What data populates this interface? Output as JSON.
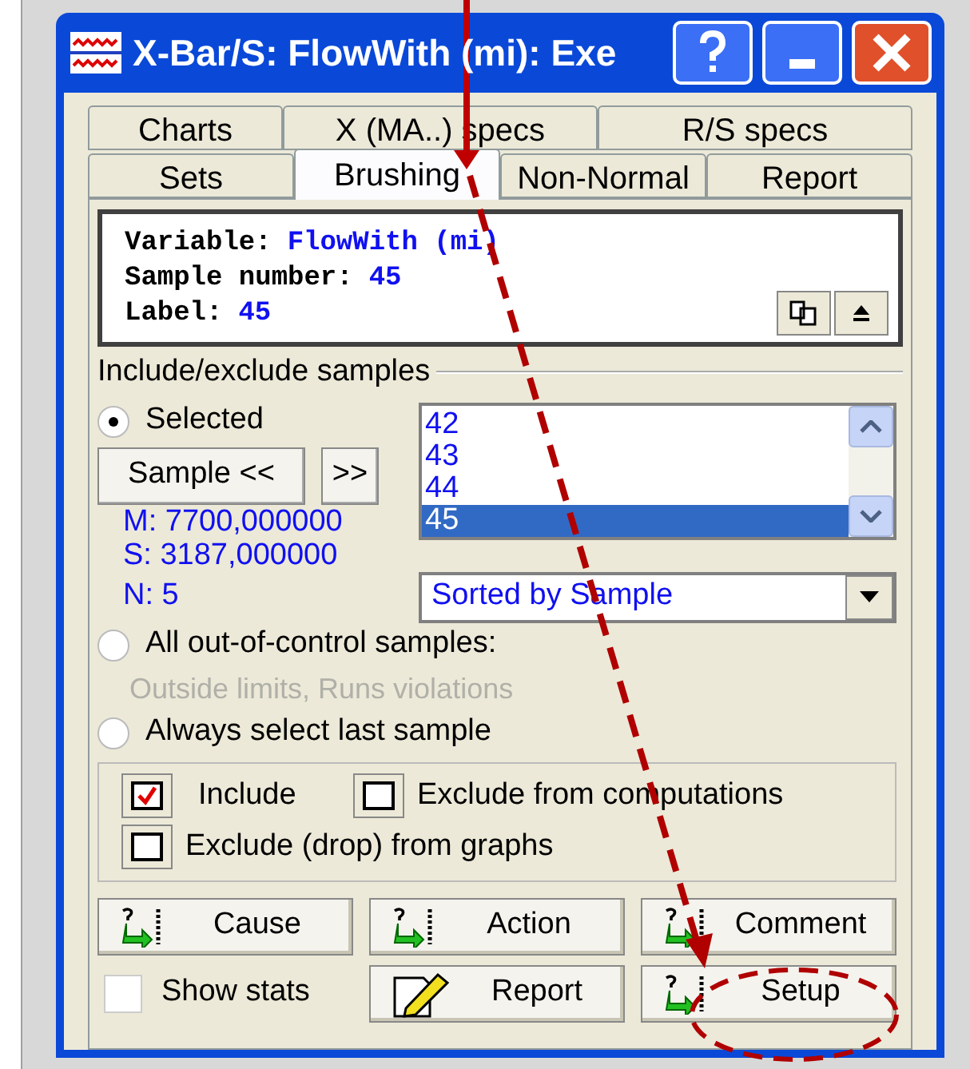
{
  "window": {
    "title": "X-Bar/S: FlowWith (mi): Exe"
  },
  "tab_rows": [
    [
      {
        "label": "Charts",
        "selected": false
      },
      {
        "label": "X (MA..) specs",
        "selected": false
      },
      {
        "label": "R/S specs",
        "selected": false
      }
    ],
    [
      {
        "label": "Sets",
        "selected": false
      },
      {
        "label": "Brushing",
        "selected": true
      },
      {
        "label": "Non-Normal",
        "selected": false
      },
      {
        "label": "Report",
        "selected": false
      }
    ]
  ],
  "info": [
    {
      "label": "Variable:",
      "value": "FlowWith (mi)"
    },
    {
      "label": "Sample number:",
      "value": "45"
    },
    {
      "label": "Label:",
      "value": "45"
    }
  ],
  "group_title": "Include/exclude samples",
  "modes": [
    {
      "label": "Selected",
      "selected": true
    },
    {
      "label": "All out-of-control samples:",
      "selected": false,
      "note": "Outside limits, Runs violations"
    },
    {
      "label": "Always select last sample",
      "selected": false
    }
  ],
  "nav_buttons": [
    "Sample <<",
    ">>"
  ],
  "stats": [
    "M: 7700,000000",
    "S: 3187,000000",
    "N: 5"
  ],
  "samples": [
    {
      "label": "42",
      "selected": false
    },
    {
      "label": "43",
      "selected": false
    },
    {
      "label": "44",
      "selected": false
    },
    {
      "label": "45",
      "selected": true
    }
  ],
  "sort": {
    "value": "Sorted by Sample"
  },
  "checks": [
    {
      "label": "Include",
      "checked": true
    },
    {
      "label": "Exclude from computations",
      "checked": false
    },
    {
      "label": "Exclude (drop) from graphs",
      "checked": false
    }
  ],
  "buttons": [
    {
      "label": "Cause",
      "kind": "arrow"
    },
    {
      "label": "Action",
      "kind": "arrow"
    },
    {
      "label": "Comment",
      "kind": "arrow"
    },
    {
      "label": "Report",
      "kind": "notepad"
    },
    {
      "label": "Setup",
      "kind": "arrow",
      "highlighted": true
    }
  ],
  "show_stats": {
    "label": "Show stats",
    "checked": false
  },
  "annotation_arrow": true
}
